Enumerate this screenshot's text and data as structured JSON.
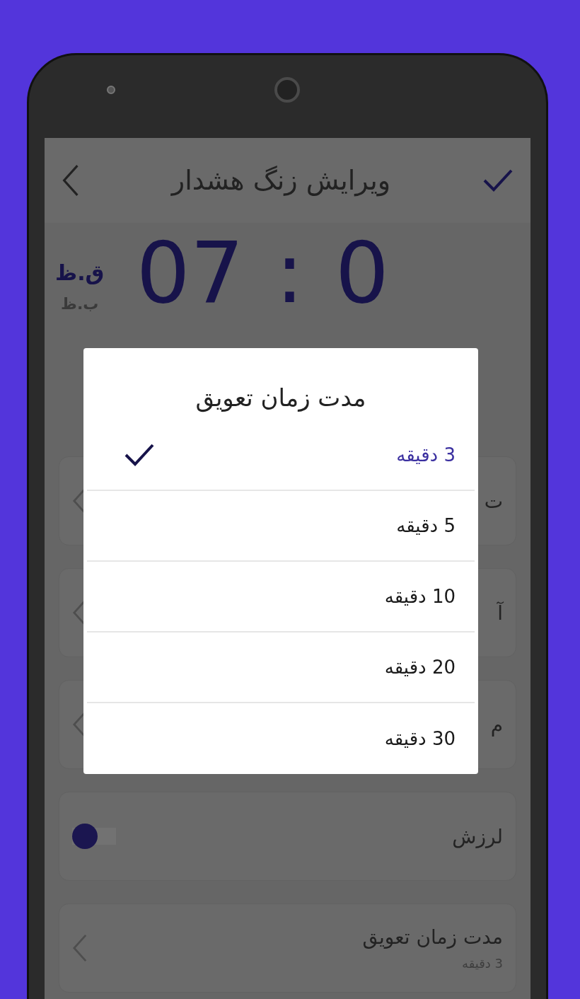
{
  "header": {
    "title": "ویرایش زنگ هشدار"
  },
  "time": {
    "digits": [
      "0",
      ":",
      "07"
    ]
  },
  "period": [
    {
      "label": "ق.ظ",
      "selected": true
    },
    {
      "label": "ب.ظ",
      "selected": false
    }
  ],
  "settings": [
    {
      "kind": "link",
      "title": "ت"
    },
    {
      "kind": "link",
      "title": "آ"
    },
    {
      "kind": "link",
      "title": "م"
    },
    {
      "kind": "toggle",
      "title": "لرزش",
      "on": true
    },
    {
      "kind": "link",
      "title": "مدت زمان تعویق",
      "value": "3 دقیقه"
    }
  ],
  "dialog": {
    "title": "مدت زمان تعویق",
    "options": [
      {
        "label": "3 دقیقه",
        "selected": true
      },
      {
        "label": "5 دقیقه",
        "selected": false
      },
      {
        "label": "10 دقیقه",
        "selected": false
      },
      {
        "label": "20 دقیقه",
        "selected": false
      },
      {
        "label": "30 دقیقه",
        "selected": false
      }
    ]
  }
}
